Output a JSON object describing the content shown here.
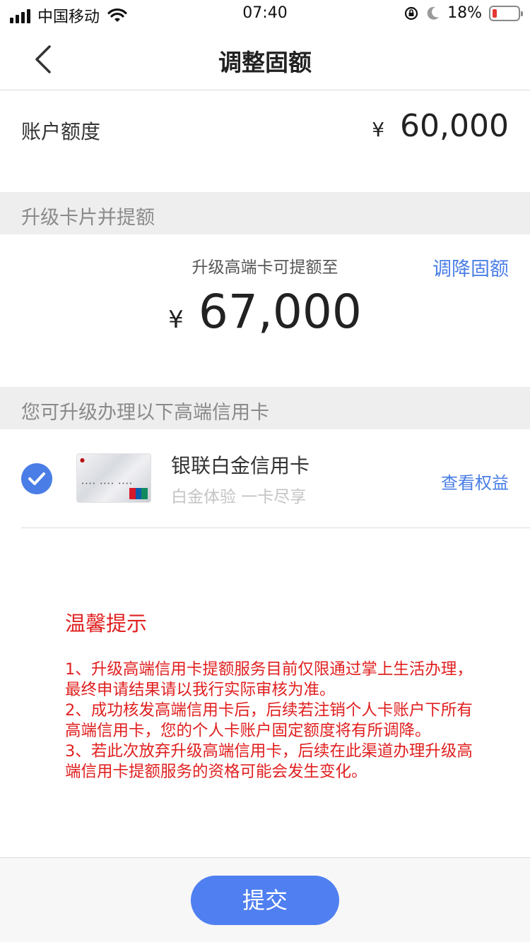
{
  "status_bar": {
    "carrier": "中国移动",
    "time": "07:40",
    "battery_percent": "18%",
    "battery_level": 0.18,
    "signal_bars": 4,
    "icons": [
      "signal-icon",
      "wifi-icon",
      "rotation-lock-icon",
      "moon-icon",
      "battery-icon"
    ]
  },
  "nav": {
    "title": "调整固额",
    "back_icon": "chevron-left-icon"
  },
  "account": {
    "label": "账户额度",
    "currency": "¥",
    "amount": "60,000"
  },
  "upgrade_section": {
    "header": "升级卡片并提额",
    "caption": "升级高端卡可提额至",
    "lower_link": "调降固额",
    "currency": "¥",
    "amount": "67,000"
  },
  "cards_section": {
    "header": "您可升级办理以下高端信用卡",
    "cards": [
      {
        "name": "银联白金信用卡",
        "subtitle": "白金体验 一卡尽享",
        "link": "查看权益",
        "selected": true,
        "check_icon": "checkmark-circle-icon"
      }
    ]
  },
  "tips": {
    "title": "温馨提示",
    "items": [
      "1、升级高端信用卡提额服务目前仅限通过掌上生活办理，最终申请结果请以我行实际审核为准。",
      "2、成功核发高端信用卡后，后续若注销个人卡账户下所有高端信用卡，您的个人卡账户固定额度将有所调降。",
      "3、若此次放弃升级高端信用卡，后续在此渠道办理升级高端信用卡提额服务的资格可能会发生变化。"
    ]
  },
  "footer": {
    "submit_label": "提交"
  },
  "colors": {
    "accent": "#4a7ee6",
    "button": "#4f7ff0",
    "warning": "#e02020",
    "section_bg": "#eeeeee"
  }
}
